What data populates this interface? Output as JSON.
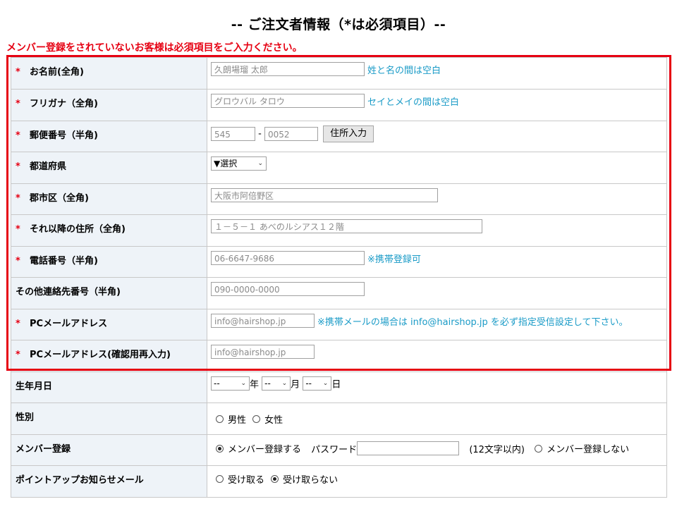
{
  "title": "-- ご注文者情報（*は必須項目）--",
  "notice": "メンバー登録をされていないお客様は必須項目をご入力ください。",
  "required_mark": "*",
  "fields": {
    "name": {
      "label": "お名前(全角)",
      "placeholder": "久朗場瑠 太郎",
      "hint": "姓と名の間は空白"
    },
    "kana": {
      "label": "フリガナ（全角)",
      "placeholder": "グロウバル タロウ",
      "hint": "セイとメイの間は空白"
    },
    "zip": {
      "label": "郵便番号（半角)",
      "placeholder1": "545",
      "sep": "-",
      "placeholder2": "0052",
      "button": "住所入力"
    },
    "pref": {
      "label": "都道府県",
      "selected": "▼選択"
    },
    "city": {
      "label": "郡市区（全角)",
      "placeholder": "大阪市阿倍野区"
    },
    "address": {
      "label": "それ以降の住所（全角)",
      "placeholder": "１－５－１ あべのルシアス１２階"
    },
    "phone": {
      "label": "電話番号（半角)",
      "placeholder": "06-6647-9686",
      "hint": "※携帯登録可"
    },
    "other_phone": {
      "label": "その他連絡先番号（半角)",
      "placeholder": "090-0000-0000"
    },
    "email": {
      "label": "PCメールアドレス",
      "placeholder": "info@hairshop.jp",
      "hint": "※携帯メールの場合は info@hairshop.jp を必ず指定受信設定して下さい。"
    },
    "email_confirm": {
      "label": "PCメールアドレス(確認用再入力)",
      "placeholder": "info@hairshop.jp"
    },
    "birthday": {
      "label": "生年月日",
      "year_sel": "--",
      "year_unit": "年",
      "month_sel": "--",
      "month_unit": "月",
      "day_sel": "--",
      "day_unit": "日"
    },
    "gender": {
      "label": "性別",
      "options": [
        "男性",
        "女性"
      ]
    },
    "member": {
      "label": "メンバー登録",
      "opt_yes": "メンバー登録する",
      "password_label": "パスワード",
      "password_note": "(12文字以内)",
      "opt_no": "メンバー登録しない"
    },
    "point_mail": {
      "label": "ポイントアップお知らせメール",
      "opt_yes": "受け取る",
      "opt_no": "受け取らない"
    }
  },
  "colors": {
    "required": "#e60012",
    "hint": "#1a9bc7",
    "label_bg": "#eef3f8",
    "frame": "#e60012"
  }
}
